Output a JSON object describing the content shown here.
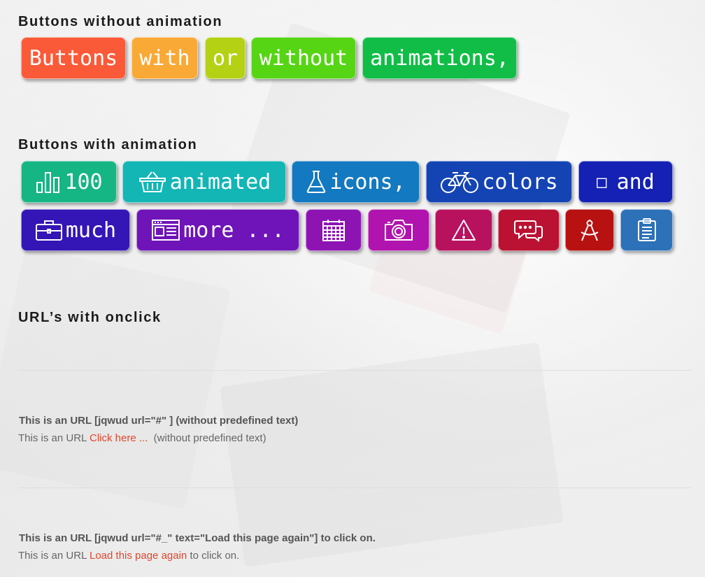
{
  "headings": {
    "without": "Buttons without animation",
    "with": "Buttons with animation",
    "urls": "URL’s with onclick"
  },
  "buttons_plain": [
    {
      "label": "Buttons",
      "color": "#fb5a38"
    },
    {
      "label": "with",
      "color": "#f9a936"
    },
    {
      "label": "or",
      "color": "#b4d114"
    },
    {
      "label": "without",
      "color": "#56d514"
    },
    {
      "label": "animations,",
      "color": "#12bd47"
    }
  ],
  "buttons_animated_row1": [
    {
      "label": "100",
      "icon": "bar-chart-icon",
      "color": "#16b584"
    },
    {
      "label": "animated",
      "icon": "basket-icon",
      "color": "#13b5b5"
    },
    {
      "label": "icons,",
      "icon": "flask-icon",
      "color": "#1379c0"
    },
    {
      "label": "colors",
      "icon": "bicycle-icon",
      "color": "#1444b4"
    },
    {
      "label": "and",
      "icon": "box-glyph-icon",
      "glyph": "□",
      "color": "#1421b4"
    }
  ],
  "buttons_animated_row2": [
    {
      "label": "much",
      "icon": "briefcase-icon",
      "color": "#3415b6"
    },
    {
      "label": "more ...",
      "icon": "browser-window-icon",
      "color": "#6f14b8"
    },
    {
      "label": "",
      "icon": "calendar-icon",
      "color": "#8d14b3"
    },
    {
      "label": "",
      "icon": "camera-icon",
      "color": "#b113ae"
    },
    {
      "label": "",
      "icon": "warning-icon",
      "color": "#b8125f"
    },
    {
      "label": "",
      "icon": "chat-bubbles-icon",
      "color": "#bb1233"
    },
    {
      "label": "",
      "icon": "compass-icon",
      "color": "#b81111"
    },
    {
      "label": "",
      "icon": "clipboard-icon",
      "color": "#2d71b8"
    }
  ],
  "urls": [
    {
      "title": "This is an URL [jqwud url=\"#\" ] (without predefined text)",
      "prefix": "This is an URL ",
      "link": "Click here ...",
      "suffix": "  (without predefined text)"
    },
    {
      "title": "This is an URL [jqwud url=\"#_\" text=\"Load this page again\"] to click on.",
      "prefix": "This is an URL ",
      "link": "Load this page again",
      "suffix": " to click on."
    }
  ]
}
